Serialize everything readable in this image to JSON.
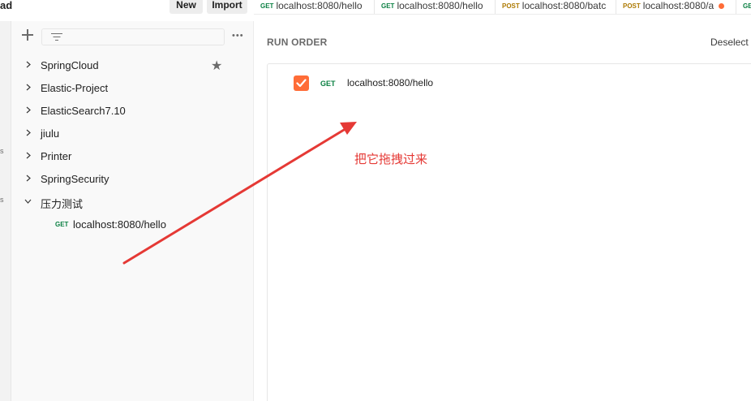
{
  "workspace": {
    "title_fragment": "ad"
  },
  "header": {
    "new_label": "New",
    "import_label": "Import"
  },
  "tabs": [
    {
      "method": "GET",
      "label": "localhost:8080/hello",
      "unsaved": false
    },
    {
      "method": "GET",
      "label": "localhost:8080/hello",
      "unsaved": false
    },
    {
      "method": "POST",
      "label": "localhost:8080/batc",
      "unsaved": false
    },
    {
      "method": "POST",
      "label": "localhost:8080/a",
      "unsaved": true
    },
    {
      "method": "GE",
      "label": "",
      "unsaved": false
    }
  ],
  "gutter": {
    "text_1": "s",
    "text_2": "s"
  },
  "sidebar": {
    "collections": [
      {
        "label": "SpringCloud",
        "expanded": false,
        "starred": true
      },
      {
        "label": "Elastic-Project",
        "expanded": false,
        "starred": false
      },
      {
        "label": "ElasticSearch7.10",
        "expanded": false,
        "starred": false
      },
      {
        "label": "jiulu",
        "expanded": false,
        "starred": false
      },
      {
        "label": "Printer",
        "expanded": false,
        "starred": false
      },
      {
        "label": "SpringSecurity",
        "expanded": false,
        "starred": false
      },
      {
        "label": "压力测试",
        "expanded": true,
        "starred": false
      }
    ],
    "requests": [
      {
        "method": "GET",
        "label": "localhost:8080/hello"
      }
    ]
  },
  "runner": {
    "heading": "RUN ORDER",
    "deselect_label": "Deselect",
    "items": [
      {
        "checked": true,
        "method": "GET",
        "label": "localhost:8080/hello"
      }
    ]
  },
  "annotation": {
    "text": "把它拖拽过来",
    "color": "#e53935"
  },
  "colors": {
    "accent": "#ff6c37",
    "get": "#0b8043",
    "post": "#ad7a03"
  }
}
